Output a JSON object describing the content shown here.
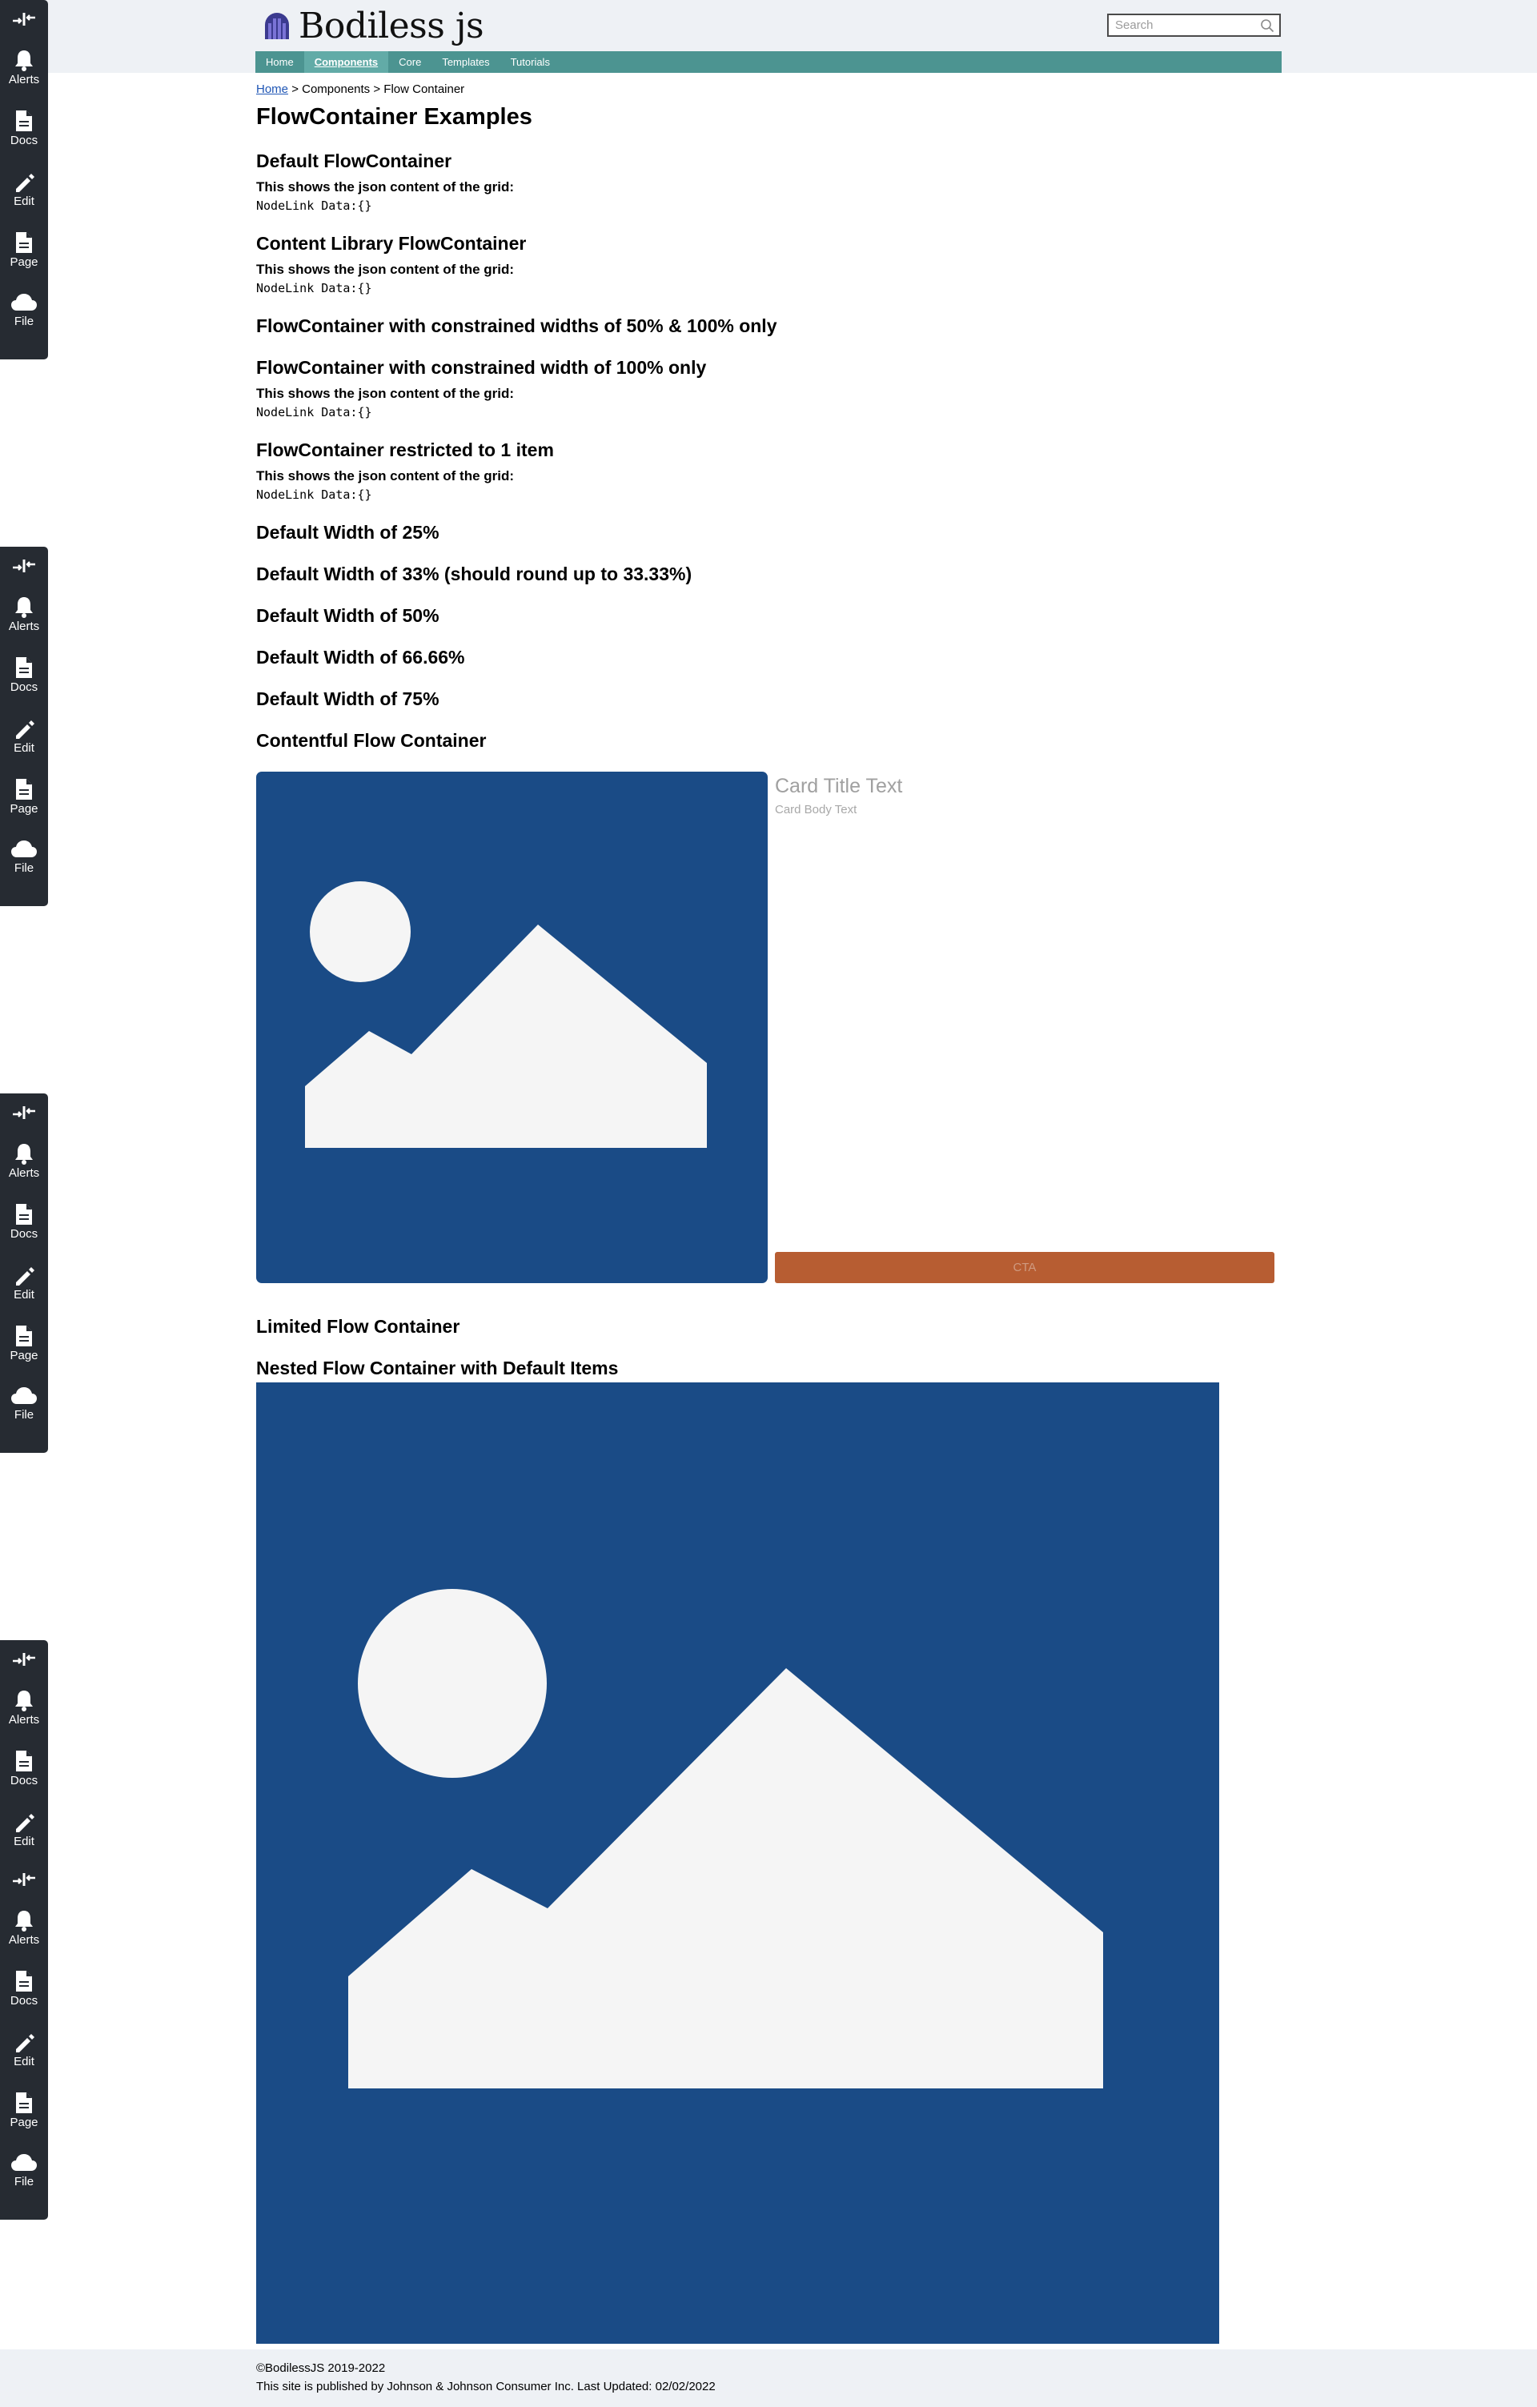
{
  "header": {
    "logo_text": "Bodiless js",
    "search_placeholder": "Search"
  },
  "nav": {
    "items": [
      {
        "label": "Home",
        "active": false
      },
      {
        "label": "Components",
        "active": true
      },
      {
        "label": "Core",
        "active": false
      },
      {
        "label": "Templates",
        "active": false
      },
      {
        "label": "Tutorials",
        "active": false
      }
    ]
  },
  "breadcrumb": {
    "home": "Home",
    "sep1": ">",
    "components": "Components",
    "sep2": ">",
    "current": "Flow Container"
  },
  "page_title": "FlowContainer Examples",
  "sections": {
    "default": {
      "heading": "Default FlowContainer",
      "json_label": "This shows the json content of the grid:",
      "json_data": "NodeLink Data:{}"
    },
    "content_library": {
      "heading": "Content Library FlowContainer",
      "json_label": "This shows the json content of the grid:",
      "json_data": "NodeLink Data:{}"
    },
    "constrained_50_100": {
      "heading": "FlowContainer with constrained widths of 50% & 100% only"
    },
    "constrained_100": {
      "heading": "FlowContainer with constrained width of 100% only",
      "json_label": "This shows the json content of the grid:",
      "json_data": "NodeLink Data:{}"
    },
    "restricted_1": {
      "heading": "FlowContainer restricted to 1 item",
      "json_label": "This shows the json content of the grid:",
      "json_data": "NodeLink Data:{}"
    },
    "width_25": {
      "heading": "Default Width of 25%"
    },
    "width_33": {
      "heading": "Default Width of 33% (should round up to 33.33%)"
    },
    "width_50": {
      "heading": "Default Width of 50%"
    },
    "width_66": {
      "heading": "Default Width of 66.66%"
    },
    "width_75": {
      "heading": "Default Width of 75%"
    },
    "contentful": {
      "heading": "Contentful Flow Container",
      "card_title": "Card Title Text",
      "card_body": "Card Body Text",
      "cta_label": "CTA"
    },
    "limited": {
      "heading": "Limited Flow Container"
    },
    "nested": {
      "heading": "Nested Flow Container with Default Items"
    }
  },
  "toolbar": {
    "items": [
      {
        "label": "",
        "icon": "swap-arrows-icon"
      },
      {
        "label": "Alerts",
        "icon": "bell-icon"
      },
      {
        "label": "Docs",
        "icon": "document-icon"
      },
      {
        "label": "Edit",
        "icon": "pencil-icon"
      },
      {
        "label": "Page",
        "icon": "page-icon"
      },
      {
        "label": "File",
        "icon": "cloud-icon"
      }
    ]
  },
  "footer": {
    "copyright": "©BodilessJS 2019-2022",
    "published": "This site is published by Johnson & Johnson Consumer Inc. Last Updated: 02/02/2022"
  },
  "colors": {
    "header_bg": "#eef1f5",
    "nav_bg": "#4c9491",
    "toolbar_bg": "#262b32",
    "image_bg": "#1a4b86",
    "cta_bg": "#b75d32"
  }
}
